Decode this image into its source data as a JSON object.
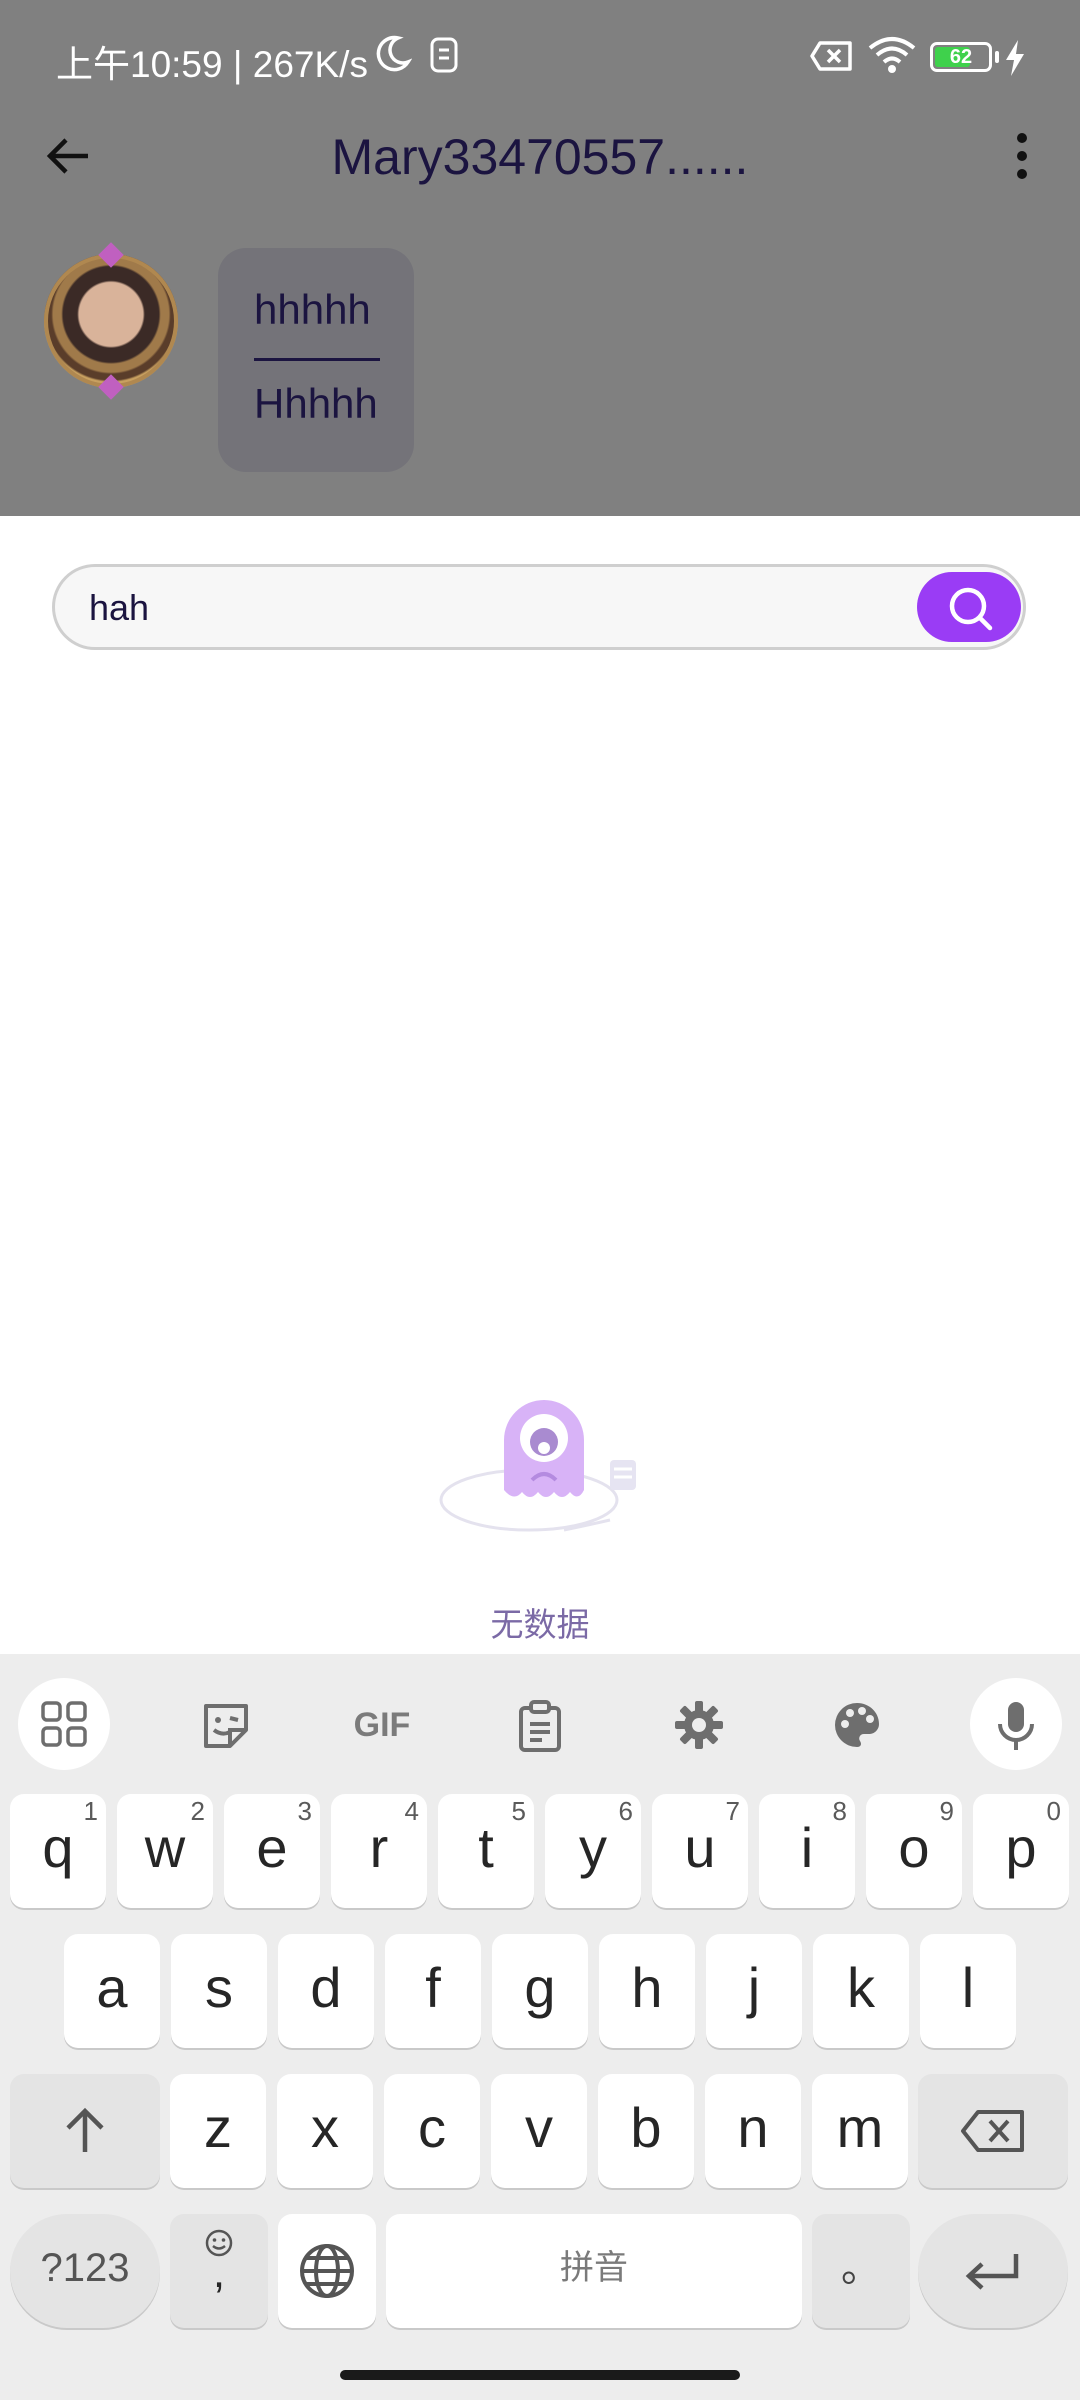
{
  "status_bar": {
    "time_and_speed": "上午10:59 | 267K/s",
    "battery_level": "62"
  },
  "header": {
    "title": "Mary33470557......"
  },
  "message": {
    "line1": "hhhhh",
    "line2": "Hhhhh"
  },
  "search": {
    "value": "hah"
  },
  "empty_state": {
    "text": "无数据"
  },
  "keyboard": {
    "toolbar": {
      "gif_label": "GIF"
    },
    "row1": [
      {
        "label": "q",
        "hint": "1"
      },
      {
        "label": "w",
        "hint": "2"
      },
      {
        "label": "e",
        "hint": "3"
      },
      {
        "label": "r",
        "hint": "4"
      },
      {
        "label": "t",
        "hint": "5"
      },
      {
        "label": "y",
        "hint": "6"
      },
      {
        "label": "u",
        "hint": "7"
      },
      {
        "label": "i",
        "hint": "8"
      },
      {
        "label": "o",
        "hint": "9"
      },
      {
        "label": "p",
        "hint": "0"
      }
    ],
    "row2": [
      "a",
      "s",
      "d",
      "f",
      "g",
      "h",
      "j",
      "k",
      "l"
    ],
    "row3": [
      "z",
      "x",
      "c",
      "v",
      "b",
      "n",
      "m"
    ],
    "symbols_label": "?123",
    "comma_label": ",",
    "space_label": "拼音",
    "period_label": "。"
  }
}
